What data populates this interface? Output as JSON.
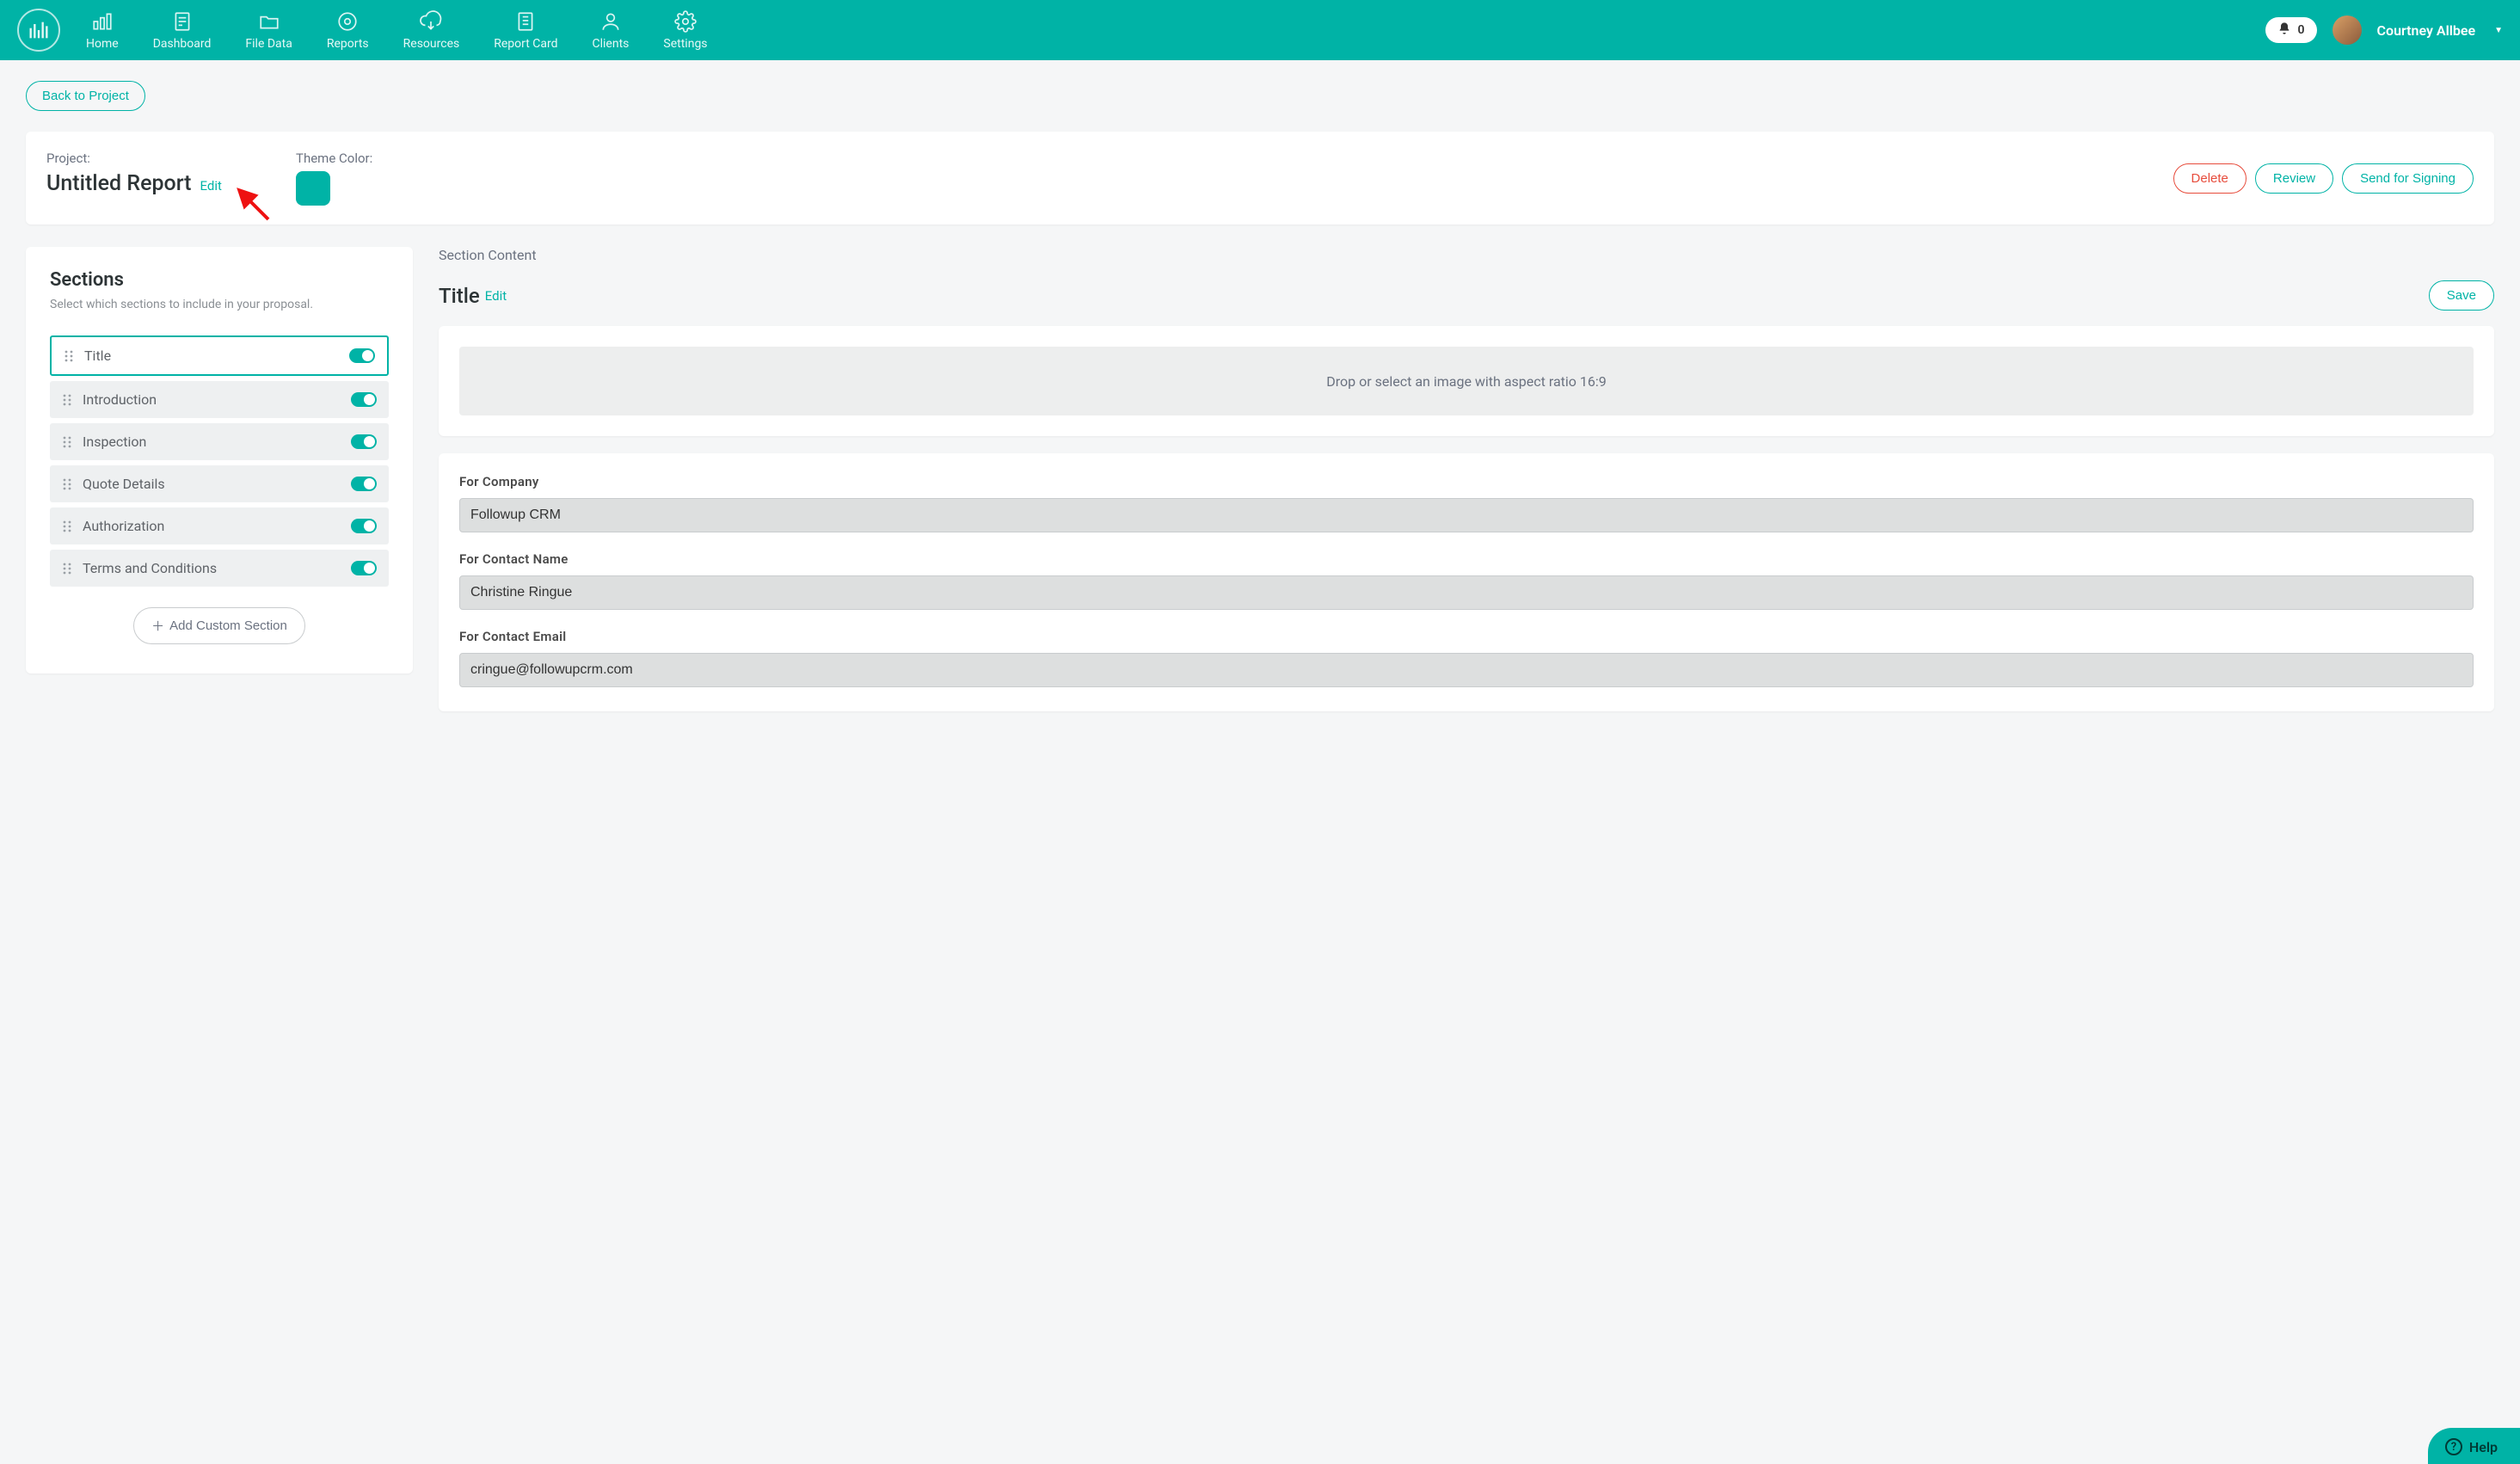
{
  "nav": {
    "items": [
      {
        "label": "Home"
      },
      {
        "label": "Dashboard"
      },
      {
        "label": "File Data"
      },
      {
        "label": "Reports"
      },
      {
        "label": "Resources"
      },
      {
        "label": "Report Card"
      },
      {
        "label": "Clients"
      },
      {
        "label": "Settings"
      }
    ],
    "notification_count": "0",
    "user_name": "Courtney Allbee"
  },
  "back_button": "Back to Project",
  "project": {
    "label": "Project:",
    "title": "Untitled Report",
    "edit": "Edit",
    "theme_label": "Theme Color:",
    "theme_color": "#00b3a6",
    "actions": {
      "delete": "Delete",
      "review": "Review",
      "send": "Send for Signing"
    }
  },
  "sections_panel": {
    "heading": "Sections",
    "subheading": "Select which sections to include in your proposal.",
    "items": [
      {
        "label": "Title",
        "on": true,
        "active": true
      },
      {
        "label": "Introduction",
        "on": true
      },
      {
        "label": "Inspection",
        "on": true
      },
      {
        "label": "Quote Details",
        "on": true
      },
      {
        "label": "Authorization",
        "on": true
      },
      {
        "label": "Terms and Conditions",
        "on": true
      }
    ],
    "add_custom": "Add Custom Section"
  },
  "content": {
    "section_content_label": "Section Content",
    "title": "Title",
    "edit": "Edit",
    "save": "Save",
    "dropzone": "Drop or select an image with aspect ratio 16:9",
    "form": {
      "company_label": "For Company",
      "company_value": "Followup CRM",
      "contact_name_label": "For Contact Name",
      "contact_name_value": "Christine Ringue",
      "contact_email_label": "For Contact Email",
      "contact_email_value": "cringue@followupcrm.com"
    }
  },
  "help": "Help"
}
